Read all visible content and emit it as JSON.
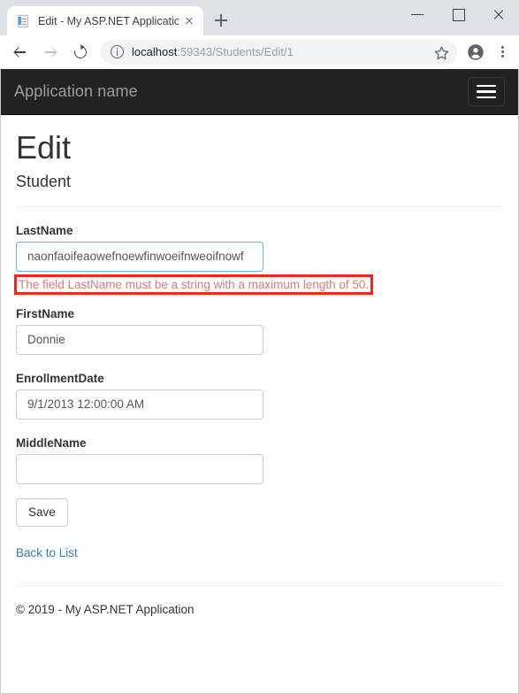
{
  "browser": {
    "tab": {
      "title": "Edit - My ASP.NET Application",
      "favicon": "document-icon",
      "close_icon": "close-icon"
    },
    "new_tab_icon": "plus-icon",
    "window_controls": {
      "minimize": "minimize-icon",
      "maximize": "maximize-icon",
      "close": "close-icon"
    },
    "nav": {
      "back_icon": "arrow-left-icon",
      "forward_icon": "arrow-right-icon",
      "reload_icon": "reload-icon"
    },
    "omnibox": {
      "info_icon": "info-circle-icon",
      "url_host": "localhost",
      "url_path": ":59343/Students/Edit/1",
      "url_full": "localhost:59343/Students/Edit/1"
    },
    "bookmark_icon": "star-icon",
    "profile_icon": "account-avatar-icon",
    "menu_icon": "kebab-menu-icon"
  },
  "page": {
    "navbar": {
      "brand": "Application name",
      "toggle_icon": "hamburger-icon"
    },
    "heading": "Edit",
    "subheading": "Student",
    "form": {
      "fields": [
        {
          "label": "LastName",
          "value": "naonfaoifeaowefnoewfinwoeifnweoifnowf",
          "placeholder": "",
          "error": "The field LastName must be a string with a maximum length of 50.",
          "invalid": true
        },
        {
          "label": "FirstName",
          "value": "Donnie",
          "placeholder": "",
          "error": "",
          "invalid": false
        },
        {
          "label": "EnrollmentDate",
          "value": "9/1/2013 12:00:00 AM",
          "placeholder": "",
          "error": "",
          "invalid": false
        },
        {
          "label": "MiddleName",
          "value": "",
          "placeholder": "",
          "error": "",
          "invalid": false
        }
      ],
      "save_label": "Save",
      "back_link": "Back to List"
    },
    "footer": "© 2019 - My ASP.NET Application"
  },
  "colors": {
    "navbar_bg": "#222222",
    "brand_text": "#9d9d9d",
    "link": "#337ab7",
    "error_text": "#e8776e",
    "error_outline": "#f4271c",
    "invalid_border": "#66afe9",
    "input_border": "#cccccc"
  }
}
